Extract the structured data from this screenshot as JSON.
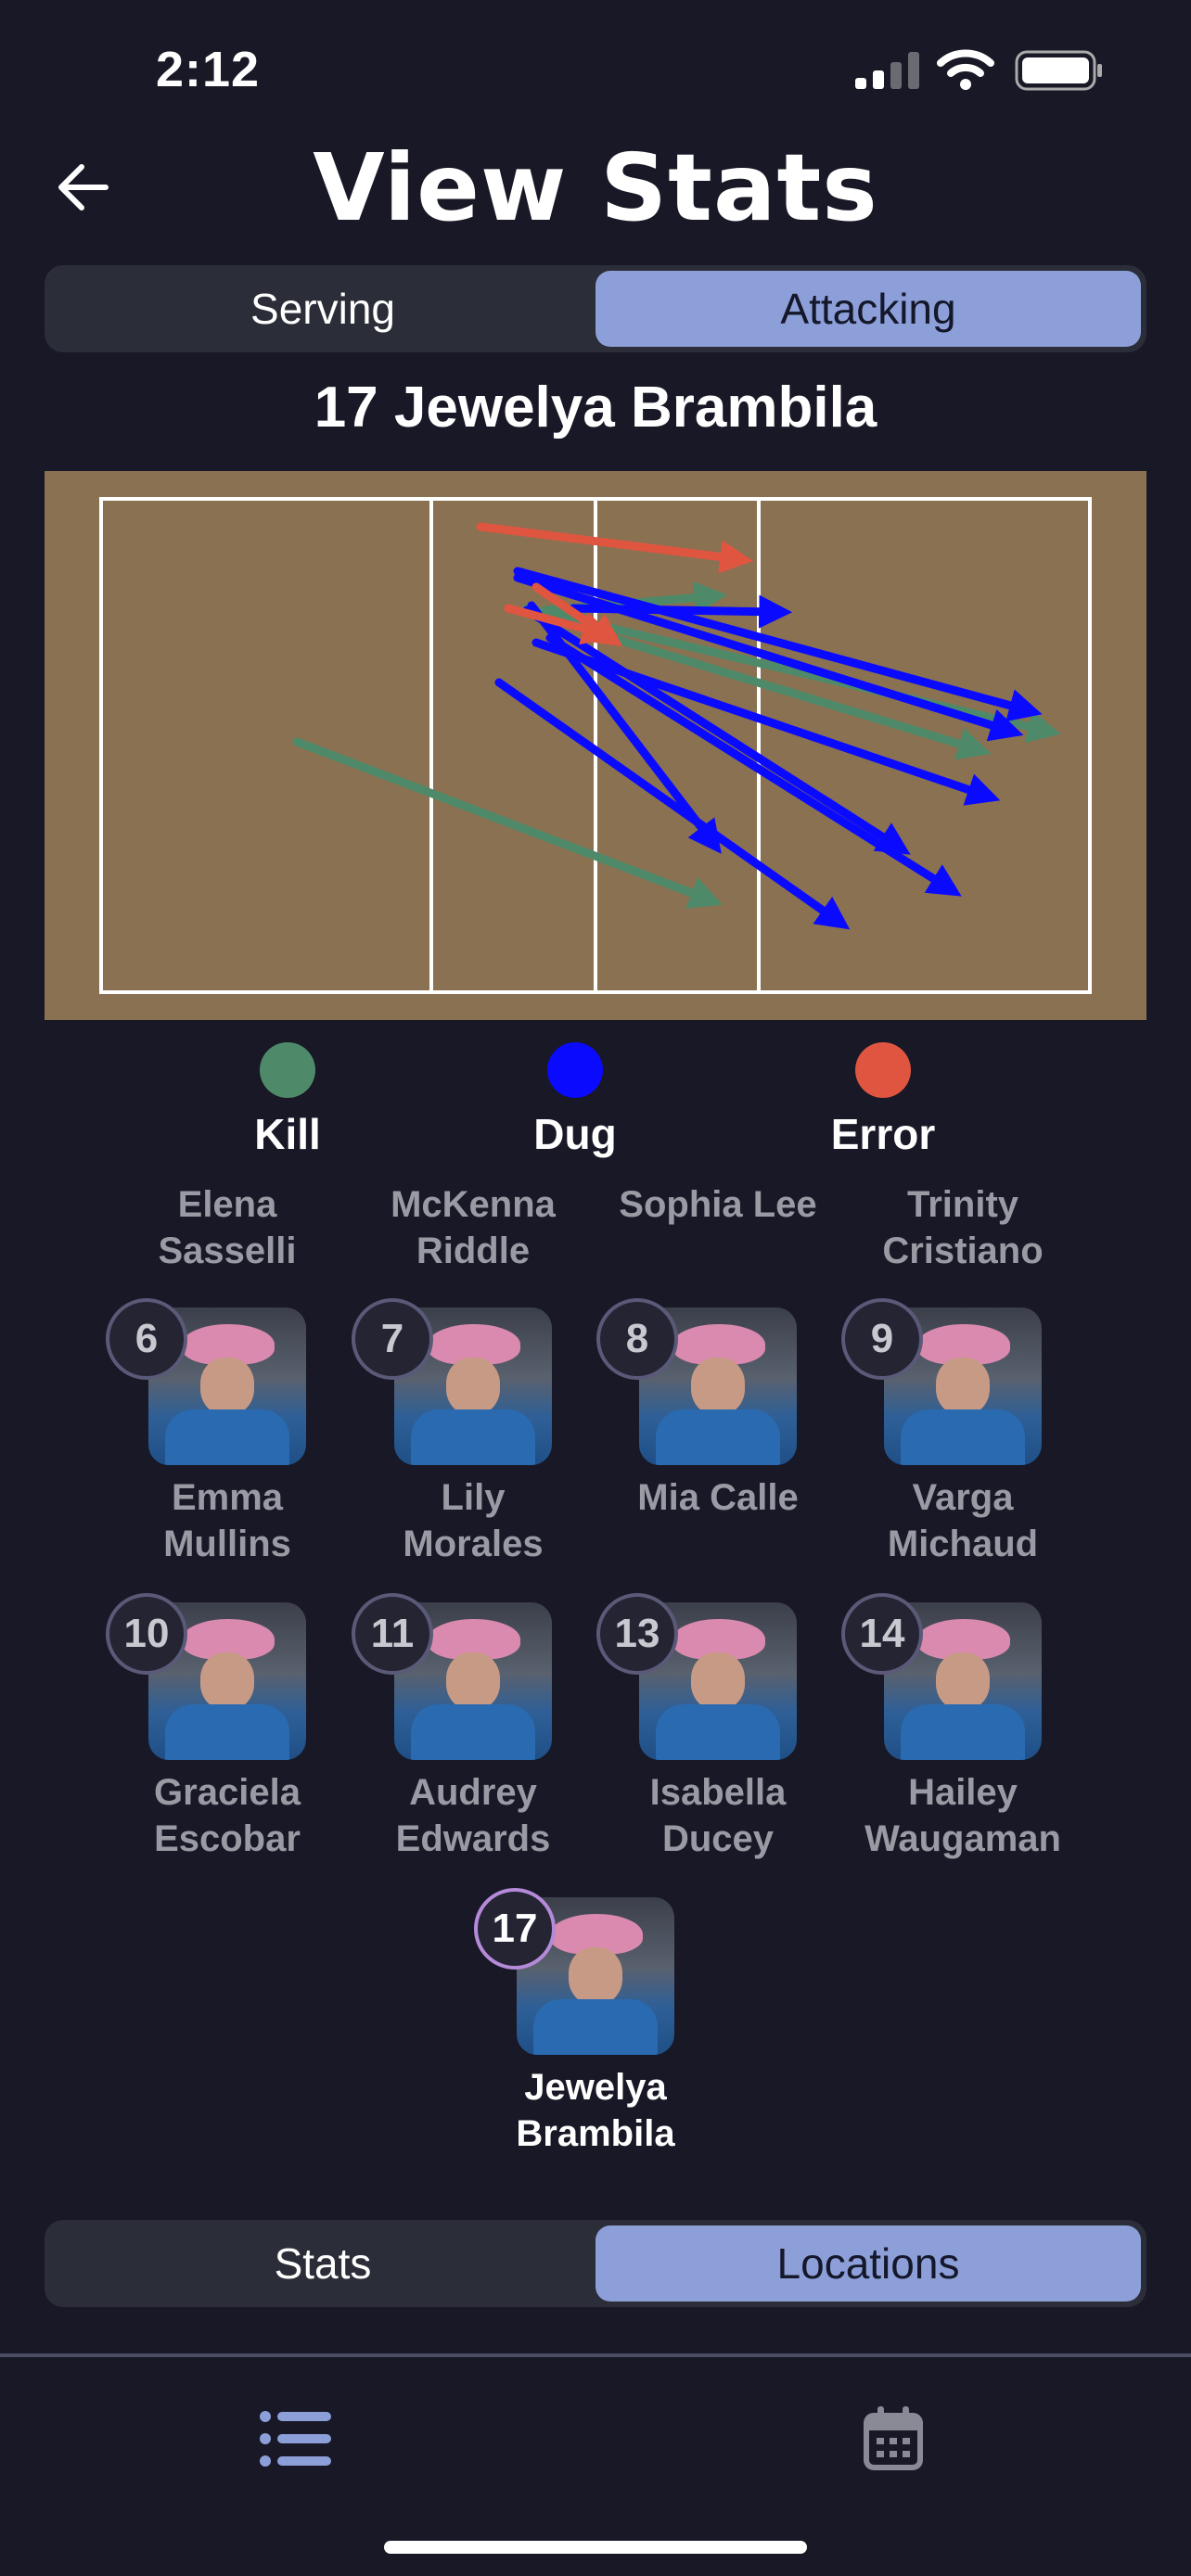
{
  "status_bar": {
    "time": "2:12",
    "icons": [
      "signal-icon",
      "wifi-icon",
      "battery-icon"
    ]
  },
  "header": {
    "title": "View Stats",
    "back_icon": "arrow-left-icon"
  },
  "stat_tabs": [
    {
      "label": "Serving",
      "active": false
    },
    {
      "label": "Attacking",
      "active": true
    }
  ],
  "selected_player": "17 Jewelya Brambila",
  "legend": [
    {
      "label": "Kill",
      "color": "#4e8a69"
    },
    {
      "label": "Dug",
      "color": "#0a0aff"
    },
    {
      "label": "Error",
      "color": "#e05540"
    }
  ],
  "no_photo_players": [
    {
      "name_line1": "Elena",
      "name_line2": "Sasselli"
    },
    {
      "name_line1": "McKenna",
      "name_line2": "Riddle"
    },
    {
      "name_line1": "Sophia Lee",
      "name_line2": ""
    },
    {
      "name_line1": "Trinity",
      "name_line2": "Cristiano"
    }
  ],
  "players": [
    {
      "number": "6",
      "name_line1": "Emma",
      "name_line2": "Mullins"
    },
    {
      "number": "7",
      "name_line1": "Lily",
      "name_line2": "Morales"
    },
    {
      "number": "8",
      "name_line1": "Mia Calle",
      "name_line2": ""
    },
    {
      "number": "9",
      "name_line1": "Varga",
      "name_line2": "Michaud"
    },
    {
      "number": "10",
      "name_line1": "Graciela",
      "name_line2": "Escobar"
    },
    {
      "number": "11",
      "name_line1": "Audrey",
      "name_line2": "Edwards"
    },
    {
      "number": "13",
      "name_line1": "Isabella",
      "name_line2": "Ducey"
    },
    {
      "number": "14",
      "name_line1": "Hailey",
      "name_line2": "Waugaman"
    },
    {
      "number": "17",
      "name_line1": "Jewelya",
      "name_line2": "Brambila",
      "active": true
    }
  ],
  "view_tabs": [
    {
      "label": "Stats",
      "active": false
    },
    {
      "label": "Locations",
      "active": true
    }
  ],
  "tab_bar": [
    {
      "icon": "list-icon",
      "active": true
    },
    {
      "icon": "calendar-icon",
      "active": false
    }
  ],
  "colors": {
    "background": "#181826",
    "accent": "#8c9fd8",
    "court": "#8a7152"
  }
}
